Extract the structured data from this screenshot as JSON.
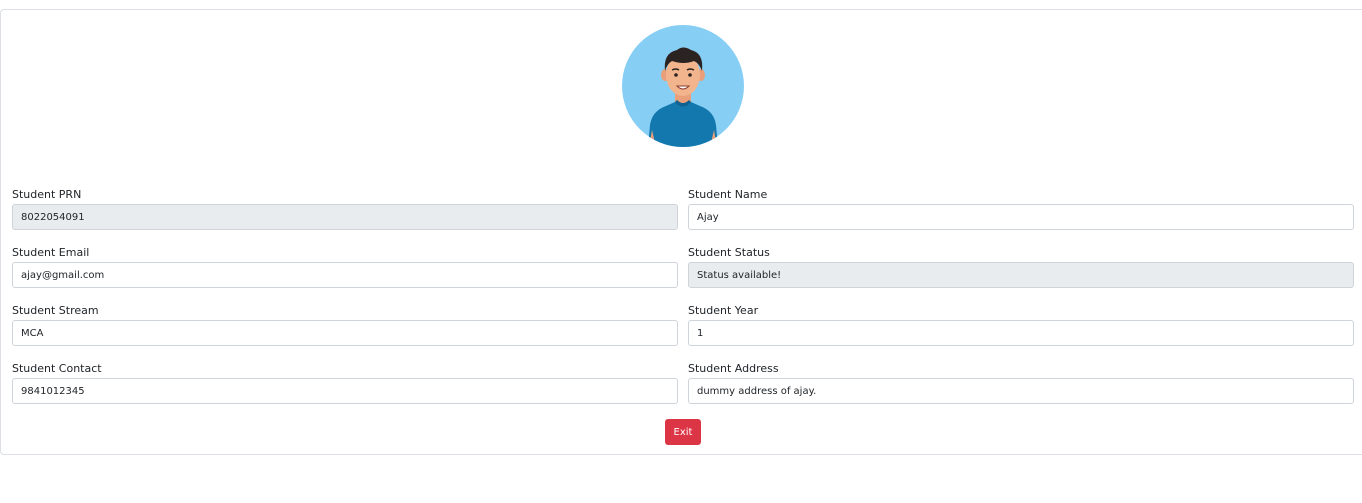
{
  "avatar": {
    "icon": "student-avatar-icon"
  },
  "fields": {
    "prn": {
      "label": "Student PRN",
      "value": "8022054091"
    },
    "name": {
      "label": "Student Name",
      "value": "Ajay"
    },
    "email": {
      "label": "Student Email",
      "value": "ajay@gmail.com"
    },
    "status": {
      "label": "Student Status",
      "value": "Status available!"
    },
    "stream": {
      "label": "Student Stream",
      "value": "MCA"
    },
    "year": {
      "label": "Student Year",
      "value": "1"
    },
    "contact": {
      "label": "Student Contact",
      "value": "9841012345"
    },
    "address": {
      "label": "Student Address",
      "value": "dummy address of ajay."
    }
  },
  "actions": {
    "exit_label": "Exit"
  },
  "colors": {
    "exit_button": "#dc3545",
    "readonly_field_bg": "#e9ecef",
    "avatar_bg": "#87cef5",
    "avatar_shirt": "#1378ad"
  }
}
